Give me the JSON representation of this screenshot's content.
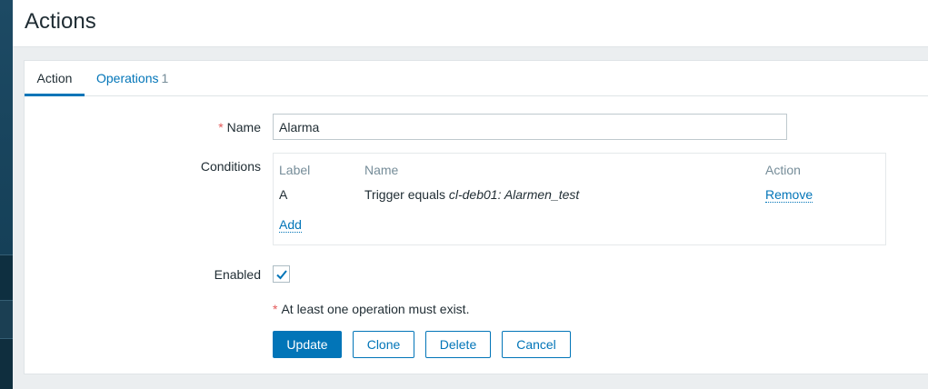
{
  "page": {
    "title": "Actions"
  },
  "tabs": [
    {
      "label": "Action"
    },
    {
      "label": "Operations",
      "count": "1"
    }
  ],
  "form": {
    "name": {
      "label": "Name",
      "required_mark": "*",
      "value": "Alarma"
    },
    "conditions": {
      "label": "Conditions",
      "headers": {
        "label": "Label",
        "name": "Name",
        "action": "Action"
      },
      "rows": [
        {
          "label": "A",
          "name_prefix": "Trigger equals ",
          "name_italic": "cl-deb01: Alarmen_test",
          "action": "Remove"
        }
      ],
      "add_label": "Add"
    },
    "enabled": {
      "label": "Enabled",
      "checked": true
    },
    "warning": {
      "mark": "*",
      "text": "At least one operation must exist."
    }
  },
  "buttons": {
    "update": "Update",
    "clone": "Clone",
    "delete": "Delete",
    "cancel": "Cancel"
  },
  "colors": {
    "accent": "#0275b8",
    "required": "#e45959",
    "muted": "#768d99"
  }
}
